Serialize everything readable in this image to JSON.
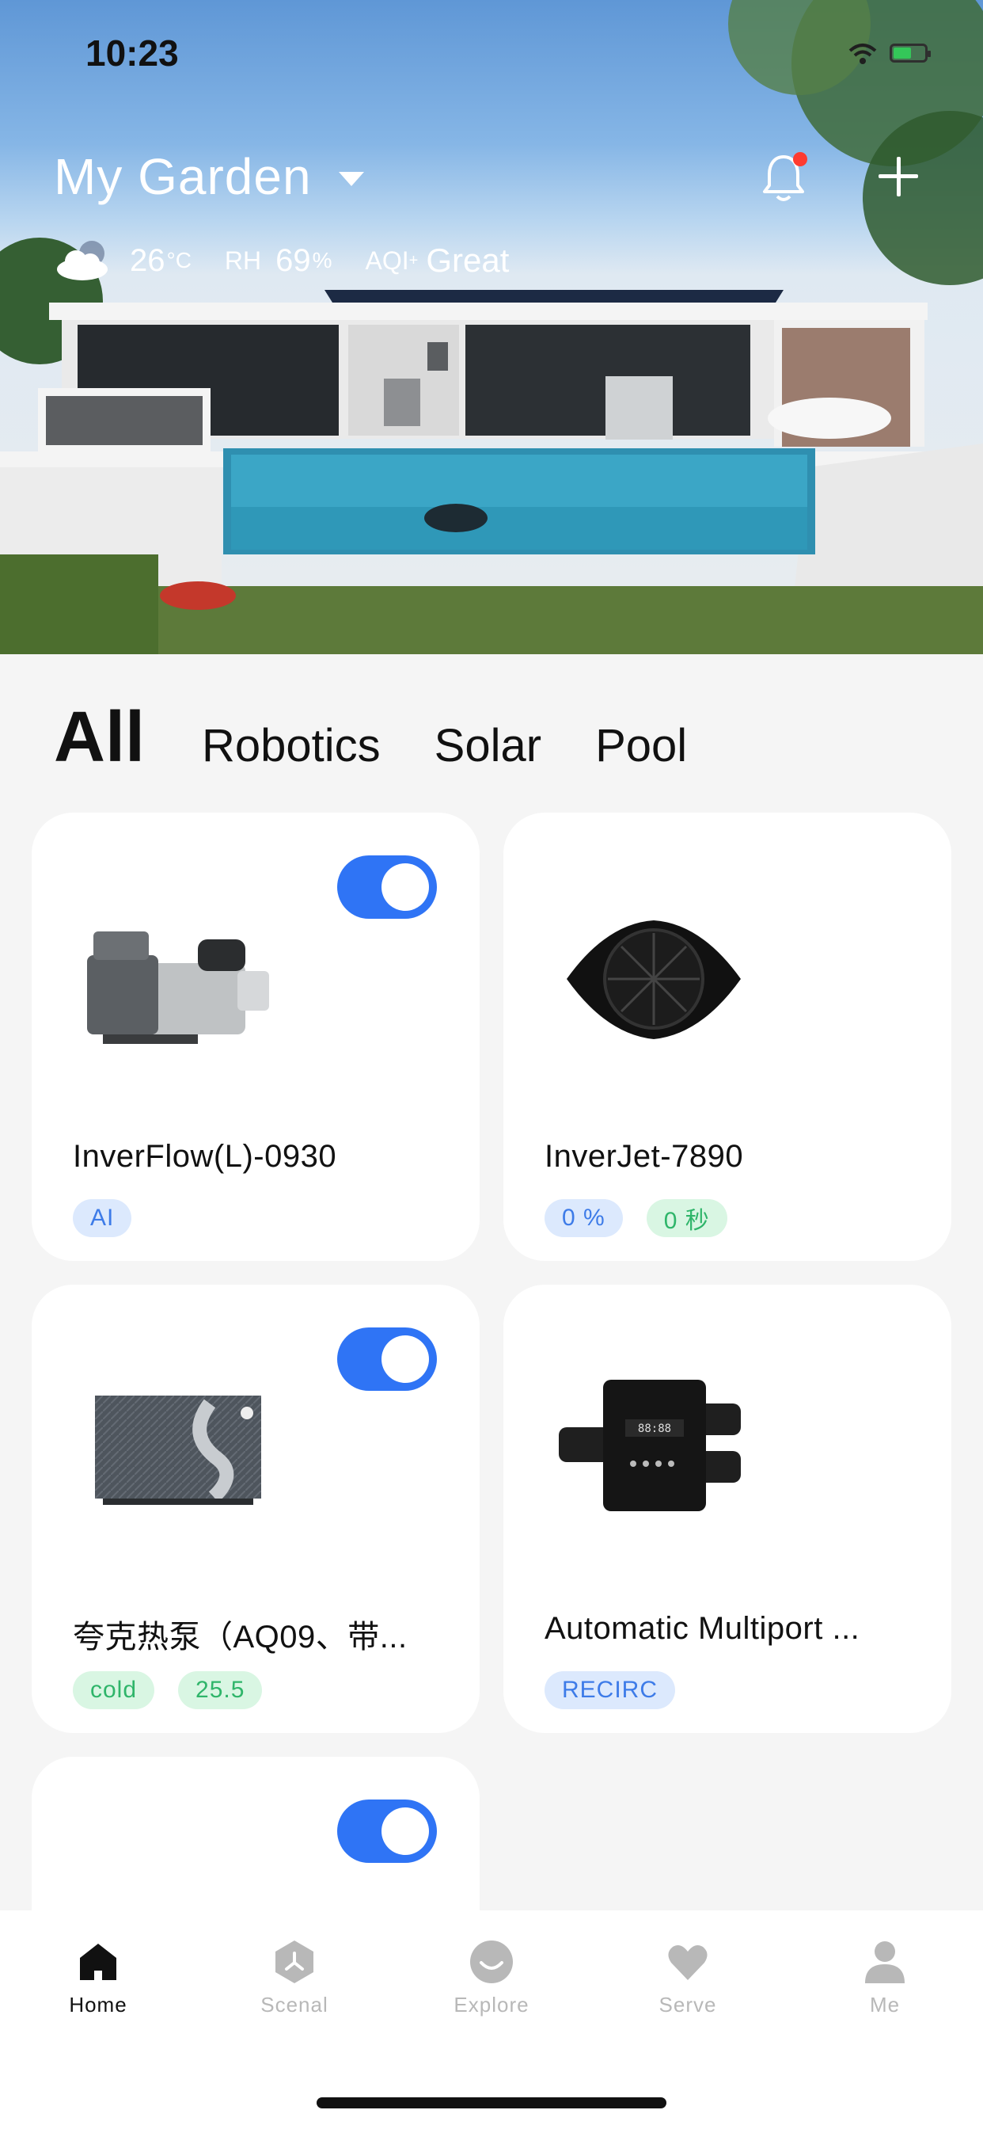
{
  "status_bar": {
    "time": "10:23"
  },
  "header": {
    "garden_name": "My Garden",
    "weather": {
      "temperature": "26",
      "temperature_unit": "°C",
      "humidity_label": "RH",
      "humidity_value": "69",
      "humidity_unit": "%",
      "aqi_label": "AQI",
      "aqi_sup": "+",
      "aqi_value": "Great"
    },
    "notification_dot_color": "#ff3b30"
  },
  "tabs": [
    {
      "label": "All",
      "active": true
    },
    {
      "label": "Robotics",
      "active": false
    },
    {
      "label": "Solar",
      "active": false
    },
    {
      "label": "Pool",
      "active": false
    }
  ],
  "devices": [
    {
      "name": "InverFlow(L)-0930",
      "icon": "pool-pump-icon",
      "toggle_on": true,
      "chips": [
        {
          "text": "AI",
          "color": "blue"
        }
      ]
    },
    {
      "name": "InverJet-7890",
      "icon": "jet-icon",
      "toggle_on": false,
      "chips": [
        {
          "text": "0 %",
          "color": "blue"
        },
        {
          "text": "0 秒",
          "color": "green"
        }
      ]
    },
    {
      "name": "夸克热泵（AQ09、带...",
      "icon": "heat-pump-icon",
      "toggle_on": true,
      "chips": [
        {
          "text": "cold",
          "color": "green"
        },
        {
          "text": "25.5",
          "color": "green"
        }
      ]
    },
    {
      "name": "Automatic Multiport ...",
      "icon": "multiport-valve-icon",
      "toggle_on": false,
      "chips": [
        {
          "text": "RECIRC",
          "color": "blue"
        }
      ]
    },
    {
      "name": "",
      "icon": "solar-panel-icon",
      "toggle_on": true,
      "chips": []
    }
  ],
  "bottom_nav": [
    {
      "label": "Home",
      "icon": "home-icon",
      "active": true
    },
    {
      "label": "Scenal",
      "icon": "scene-icon",
      "active": false
    },
    {
      "label": "Explore",
      "icon": "explore-icon",
      "active": false
    },
    {
      "label": "Serve",
      "icon": "heart-icon",
      "active": false
    },
    {
      "label": "Me",
      "icon": "user-icon",
      "active": false
    }
  ],
  "colors": {
    "accent": "#2f74f5",
    "chip_blue": "#dce9fd",
    "chip_green": "#d9f6e3"
  }
}
